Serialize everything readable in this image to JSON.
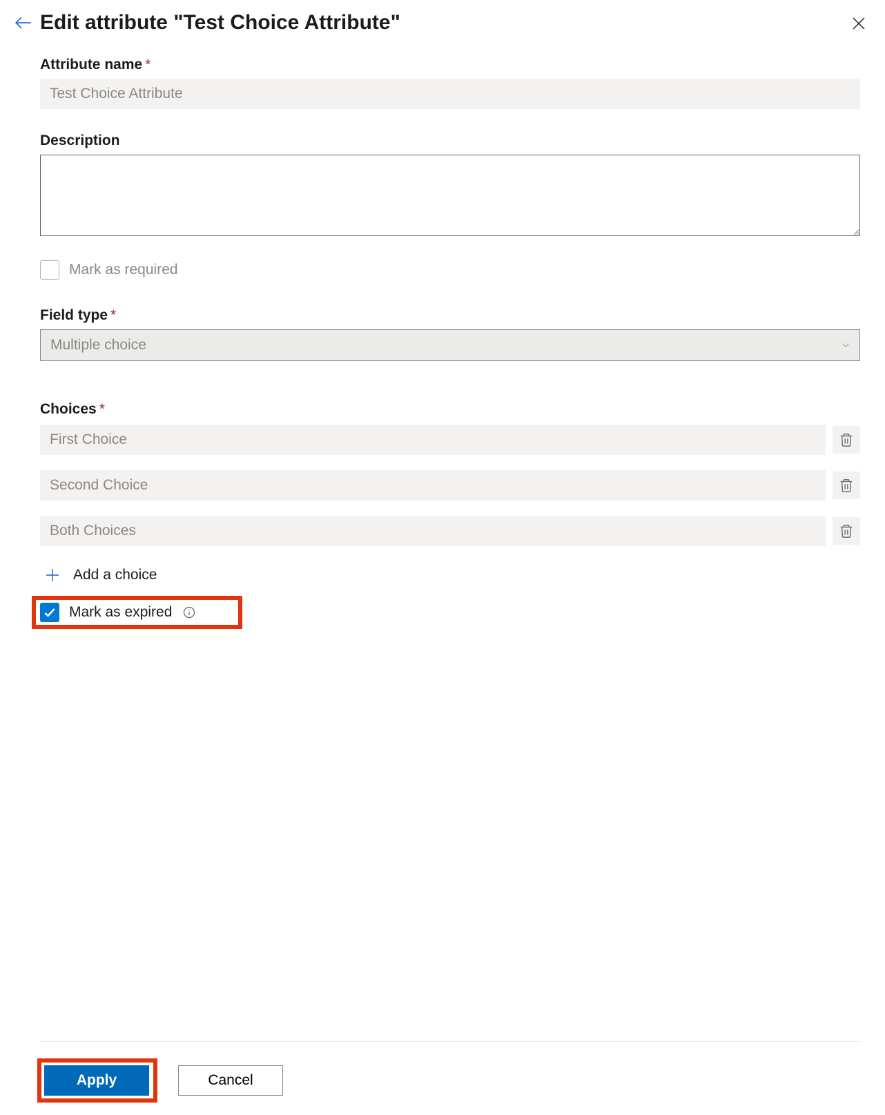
{
  "header": {
    "title": "Edit attribute \"Test Choice Attribute\""
  },
  "form": {
    "attribute_name_label": "Attribute name",
    "attribute_name_value": "Test Choice Attribute",
    "description_label": "Description",
    "description_value": "",
    "mark_required": {
      "label": "Mark as required",
      "checked": false
    },
    "field_type_label": "Field type",
    "field_type_value": "Multiple choice",
    "choices_label": "Choices",
    "choices": [
      {
        "value": "First Choice"
      },
      {
        "value": "Second Choice"
      },
      {
        "value": "Both Choices"
      }
    ],
    "add_choice_label": "Add a choice",
    "mark_expired": {
      "label": "Mark as expired",
      "checked": true
    }
  },
  "footer": {
    "apply": "Apply",
    "cancel": "Cancel"
  }
}
